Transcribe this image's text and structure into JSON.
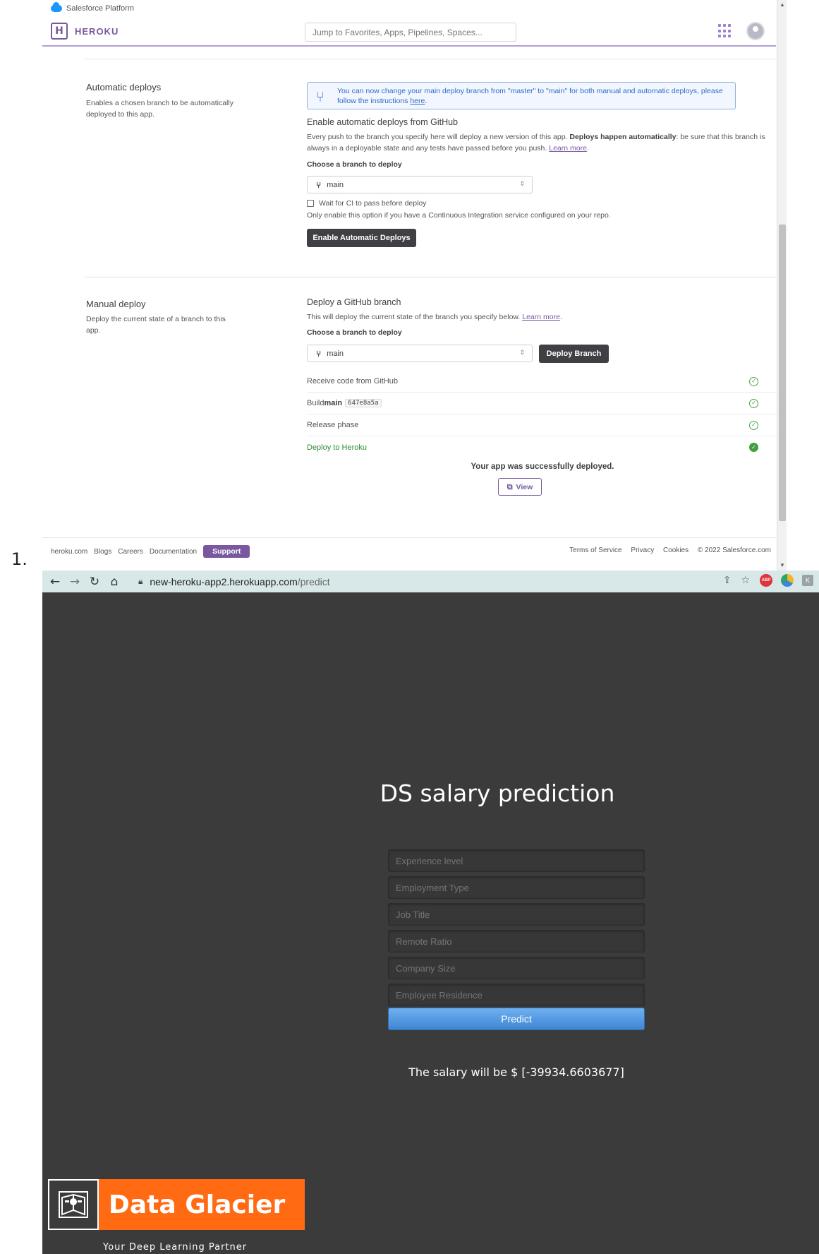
{
  "list_marker": "1.",
  "heroku": {
    "salesforce_label": "Salesforce Platform",
    "logo_letter": "H",
    "brand": "HEROKU",
    "search_placeholder": "Jump to Favorites, Apps, Pipelines, Spaces...",
    "automatic": {
      "title": "Automatic deploys",
      "description": "Enables a chosen branch to be automatically deployed to this app.",
      "notice_text": "You can now change your main deploy branch from \"master\" to \"main\" for both manual and automatic deploys, please follow the instructions ",
      "notice_link": "here",
      "subheading": "Enable automatic deploys from GitHub",
      "para_1": "Every push to the branch you specify here will deploy a new version of this app. ",
      "para_bold": "Deploys happen automatically",
      "para_2": ": be sure that this branch is always in a deployable state and any tests have passed before you push. ",
      "learn_more": "Learn more",
      "choose_label": "Choose a branch to deploy",
      "branch": "main",
      "ci_label": "Wait for CI to pass before deploy",
      "ci_note": "Only enable this option if you have a Continuous Integration service configured on your repo.",
      "enable_button": "Enable Automatic Deploys"
    },
    "manual": {
      "title": "Manual deploy",
      "description": "Deploy the current state of a branch to this app.",
      "subheading": "Deploy a GitHub branch",
      "para": "This will deploy the current state of the branch you specify below. ",
      "learn_more": "Learn more",
      "choose_label": "Choose a branch to deploy",
      "branch": "main",
      "deploy_button": "Deploy Branch",
      "steps": [
        {
          "label": "Receive code from GitHub"
        },
        {
          "label": "Build ",
          "bold": "main",
          "sha": "647e8a5a"
        },
        {
          "label": "Release phase"
        },
        {
          "label": "Deploy to Heroku"
        }
      ],
      "success": "Your app was successfully deployed.",
      "view_button": "View"
    },
    "footer": {
      "links": [
        "heroku.com",
        "Blogs",
        "Careers",
        "Documentation"
      ],
      "support": "Support",
      "right_links": [
        "Terms of Service",
        "Privacy",
        "Cookies",
        "© 2022 Salesforce.com"
      ]
    },
    "colors": {
      "accent": "#79589f",
      "success": "#3fa03f",
      "info": "#2f6ac6"
    }
  },
  "chrome": {
    "url_host": "new-heroku-app2.herokuapp.com",
    "url_path": "/predict"
  },
  "app": {
    "title": "DS salary prediction",
    "fields": [
      {
        "placeholder": "Experience level"
      },
      {
        "placeholder": "Employment Type"
      },
      {
        "placeholder": "Job Title"
      },
      {
        "placeholder": "Remote Ratio"
      },
      {
        "placeholder": "Company Size"
      },
      {
        "placeholder": "Employee Residence"
      }
    ],
    "predict_button": "Predict",
    "result": "The salary will be $ [-39934.6603677]",
    "brand_name": "Data Glacier",
    "brand_tagline": "Your Deep Learning Partner",
    "colors": {
      "background": "#3b3b3b",
      "brand": "#ff6a13",
      "button": "#4a90d9"
    }
  }
}
